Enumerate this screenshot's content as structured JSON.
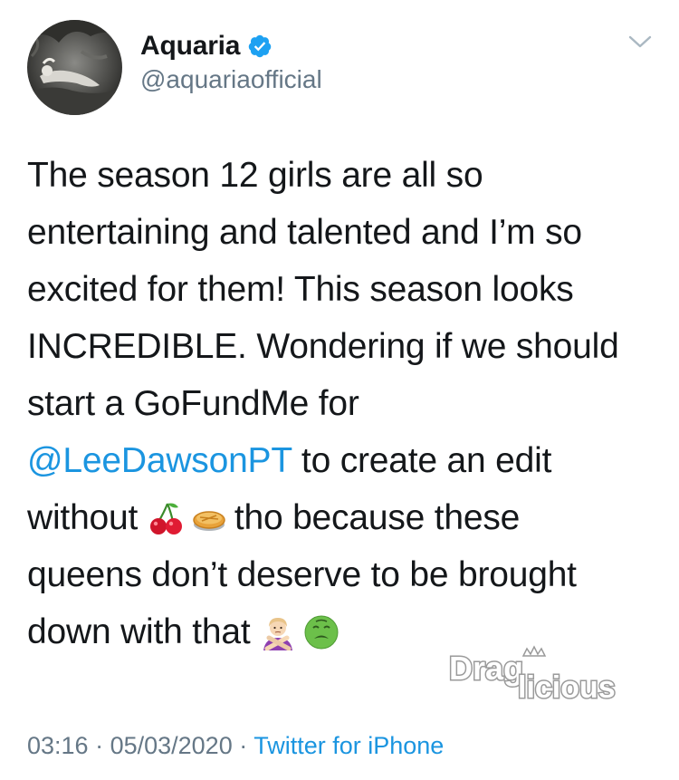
{
  "author": {
    "display_name": "Aquaria",
    "handle": "@aquariaofficial",
    "verified": true
  },
  "tweet": {
    "lines": [
      [
        {
          "t": "text",
          "v": "The season 12 girls are all so"
        }
      ],
      [
        {
          "t": "text",
          "v": "entertaining and talented and I’m so"
        }
      ],
      [
        {
          "t": "text",
          "v": "excited for them! This season looks"
        }
      ],
      [
        {
          "t": "text",
          "v": "INCREDIBLE. Wondering if we should"
        }
      ],
      [
        {
          "t": "text",
          "v": "start a GoFundMe for"
        }
      ],
      [
        {
          "t": "mention",
          "v": "@LeeDawsonPT"
        },
        {
          "t": "text",
          "v": " to create an edit"
        }
      ],
      [
        {
          "t": "text",
          "v": "without "
        },
        {
          "t": "emoji",
          "v": "cherries-icon"
        },
        {
          "t": "emoji",
          "v": "pie-icon"
        },
        {
          "t": "text",
          "v": "tho because these"
        }
      ],
      [
        {
          "t": "text",
          "v": "queens don’t deserve to be brought"
        }
      ],
      [
        {
          "t": "text",
          "v": "down with that "
        },
        {
          "t": "emoji",
          "v": "person-gesturing-no-icon"
        },
        {
          "t": "emoji",
          "v": "nauseated-face-icon"
        }
      ]
    ]
  },
  "meta": {
    "time": "03:16",
    "date": "05/03/2020",
    "separator": " · ",
    "source": "Twitter for iPhone"
  },
  "watermark": {
    "text": "Dragilicious"
  },
  "icons": {
    "verified": "verified-badge-icon",
    "menu": "chevron-down-icon"
  },
  "colors": {
    "text": "#14171a",
    "secondary": "#657786",
    "link": "#1b95e0",
    "verified": "#1da1f2"
  }
}
